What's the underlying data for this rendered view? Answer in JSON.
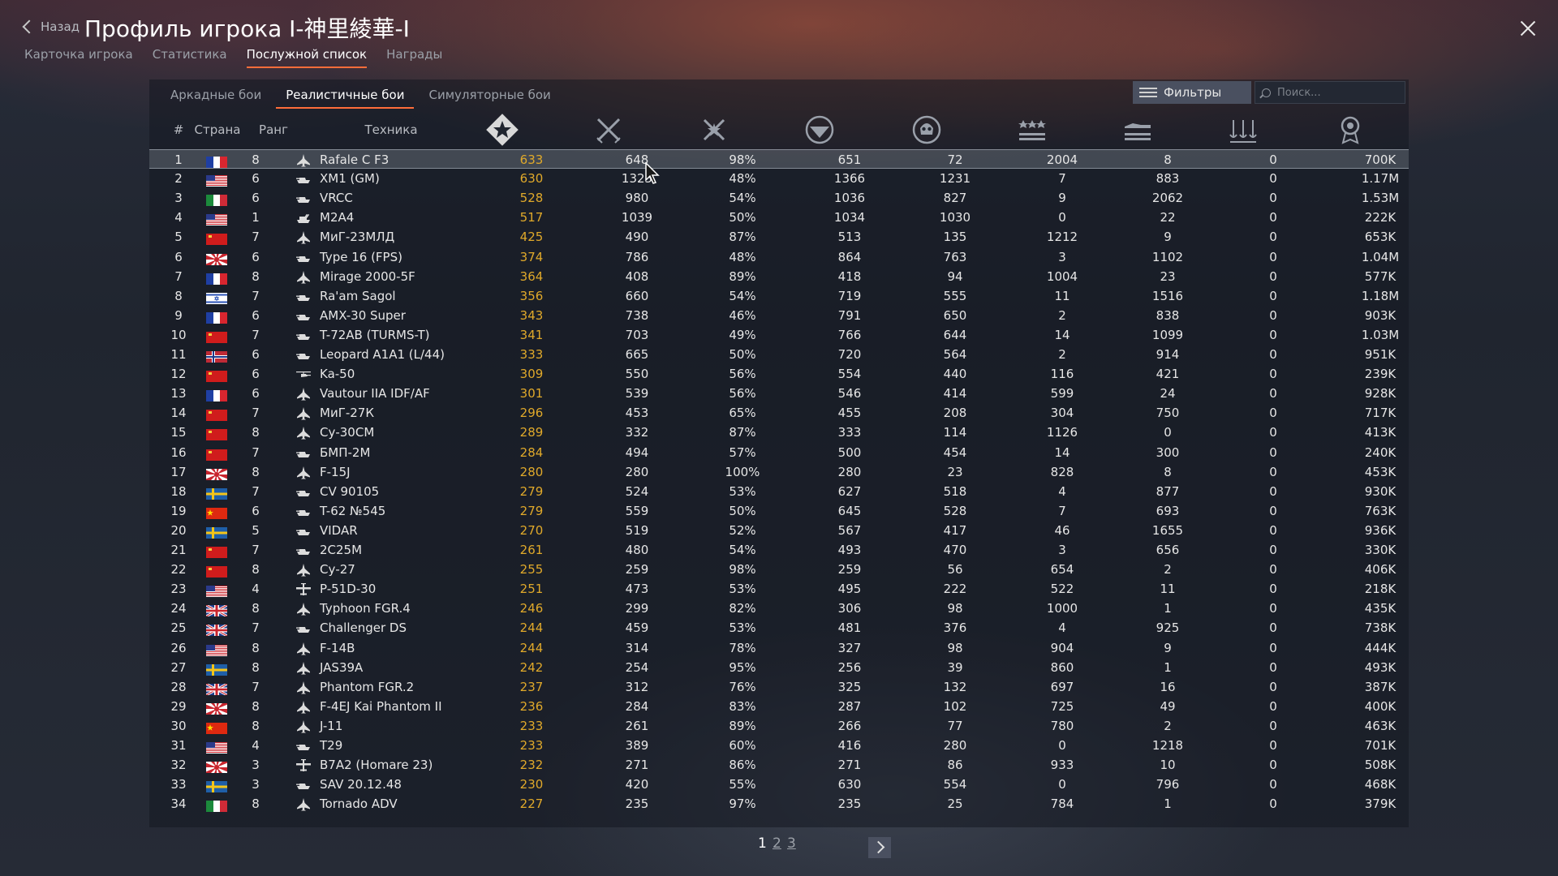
{
  "header": {
    "back_label": "Назад",
    "title": "Профиль игрока I-神里綾華-I",
    "tabs": [
      {
        "label": "Карточка игрока",
        "active": false
      },
      {
        "label": "Статистика",
        "active": false
      },
      {
        "label": "Послужной список",
        "active": true
      },
      {
        "label": "Награды",
        "active": false
      }
    ]
  },
  "modes": [
    {
      "label": "Аркадные бои",
      "active": false
    },
    {
      "label": "Реалистичные бои",
      "active": true
    },
    {
      "label": "Симуляторные бои",
      "active": false
    }
  ],
  "toolbar": {
    "filters_label": "Фильтры",
    "search_placeholder": "Поиск..."
  },
  "columns": {
    "index": "#",
    "country": "Страна",
    "rank": "Ранг",
    "vehicle": "Техника",
    "icons": [
      "rating-icon",
      "battles-icon",
      "win-rate-icon",
      "respawns-icon",
      "deaths-icon",
      "air-kills-icon",
      "ground-kills-icon",
      "naval-kills-icon",
      "silver-lions-icon"
    ]
  },
  "colors": {
    "accent": "#ff6d3a",
    "rating": "#e0a92a",
    "selected_row": "#5b626f"
  },
  "rows": [
    {
      "idx": "1",
      "flag": "fr",
      "rank": "8",
      "type": "jet",
      "name": "Rafale C F3",
      "rating": "633",
      "battles": "648",
      "win": "98%",
      "respawns": "651",
      "deaths": "72",
      "air": "2004",
      "ground": "8",
      "naval": "0",
      "sl": "700K"
    },
    {
      "idx": "2",
      "flag": "us",
      "rank": "6",
      "type": "tank",
      "name": "XM1 (GM)",
      "rating": "630",
      "battles": "1325",
      "win": "48%",
      "respawns": "1366",
      "deaths": "1231",
      "air": "7",
      "ground": "883",
      "naval": "0",
      "sl": "1.17M"
    },
    {
      "idx": "3",
      "flag": "it",
      "rank": "6",
      "type": "tank",
      "name": "VRCC",
      "rating": "528",
      "battles": "980",
      "win": "54%",
      "respawns": "1036",
      "deaths": "827",
      "air": "9",
      "ground": "2062",
      "naval": "0",
      "sl": "1.53M"
    },
    {
      "idx": "4",
      "flag": "us",
      "rank": "1",
      "type": "spaa",
      "name": "M2A4",
      "rating": "517",
      "battles": "1039",
      "win": "50%",
      "respawns": "1034",
      "deaths": "1030",
      "air": "0",
      "ground": "22",
      "naval": "0",
      "sl": "222K"
    },
    {
      "idx": "5",
      "flag": "su",
      "rank": "7",
      "type": "jet",
      "name": "МиГ-23МЛД",
      "rating": "425",
      "battles": "490",
      "win": "87%",
      "respawns": "513",
      "deaths": "135",
      "air": "1212",
      "ground": "9",
      "naval": "0",
      "sl": "653K"
    },
    {
      "idx": "6",
      "flag": "jp",
      "rank": "6",
      "type": "tank",
      "name": "Type 16 (FPS)",
      "rating": "374",
      "battles": "786",
      "win": "48%",
      "respawns": "864",
      "deaths": "763",
      "air": "3",
      "ground": "1102",
      "naval": "0",
      "sl": "1.04M"
    },
    {
      "idx": "7",
      "flag": "fr",
      "rank": "8",
      "type": "jet",
      "name": "Mirage 2000-5F",
      "rating": "364",
      "battles": "408",
      "win": "89%",
      "respawns": "418",
      "deaths": "94",
      "air": "1004",
      "ground": "23",
      "naval": "0",
      "sl": "577K"
    },
    {
      "idx": "8",
      "flag": "il",
      "rank": "7",
      "type": "tank",
      "name": "Ra'am Sagol",
      "rating": "356",
      "battles": "660",
      "win": "54%",
      "respawns": "719",
      "deaths": "555",
      "air": "11",
      "ground": "1516",
      "naval": "0",
      "sl": "1.18M"
    },
    {
      "idx": "9",
      "flag": "fr",
      "rank": "6",
      "type": "tank",
      "name": "AMX-30 Super",
      "rating": "343",
      "battles": "738",
      "win": "46%",
      "respawns": "791",
      "deaths": "650",
      "air": "2",
      "ground": "838",
      "naval": "0",
      "sl": "903K"
    },
    {
      "idx": "10",
      "flag": "su",
      "rank": "7",
      "type": "tank",
      "name": "T-72AB (TURMS-T)",
      "rating": "341",
      "battles": "703",
      "win": "49%",
      "respawns": "766",
      "deaths": "644",
      "air": "14",
      "ground": "1099",
      "naval": "0",
      "sl": "1.03M"
    },
    {
      "idx": "11",
      "flag": "no",
      "rank": "6",
      "type": "tank",
      "name": "Leopard A1A1 (L/44)",
      "rating": "333",
      "battles": "665",
      "win": "50%",
      "respawns": "720",
      "deaths": "564",
      "air": "2",
      "ground": "914",
      "naval": "0",
      "sl": "951K"
    },
    {
      "idx": "12",
      "flag": "su",
      "rank": "6",
      "type": "heli",
      "name": "Ka-50",
      "rating": "309",
      "battles": "550",
      "win": "56%",
      "respawns": "554",
      "deaths": "440",
      "air": "116",
      "ground": "421",
      "naval": "0",
      "sl": "239K"
    },
    {
      "idx": "13",
      "flag": "fr",
      "rank": "6",
      "type": "jet",
      "name": "Vautour IIA IDF/AF",
      "rating": "301",
      "battles": "539",
      "win": "56%",
      "respawns": "546",
      "deaths": "414",
      "air": "599",
      "ground": "24",
      "naval": "0",
      "sl": "928K"
    },
    {
      "idx": "14",
      "flag": "su",
      "rank": "7",
      "type": "jet",
      "name": "МиГ-27К",
      "rating": "296",
      "battles": "453",
      "win": "65%",
      "respawns": "455",
      "deaths": "208",
      "air": "304",
      "ground": "750",
      "naval": "0",
      "sl": "717K"
    },
    {
      "idx": "15",
      "flag": "su",
      "rank": "8",
      "type": "jet",
      "name": "Су-30СМ",
      "rating": "289",
      "battles": "332",
      "win": "87%",
      "respawns": "333",
      "deaths": "114",
      "air": "1126",
      "ground": "0",
      "naval": "0",
      "sl": "413K"
    },
    {
      "idx": "16",
      "flag": "su",
      "rank": "7",
      "type": "tank",
      "name": "БМП-2М",
      "rating": "284",
      "battles": "494",
      "win": "57%",
      "respawns": "500",
      "deaths": "454",
      "air": "14",
      "ground": "300",
      "naval": "0",
      "sl": "240K"
    },
    {
      "idx": "17",
      "flag": "jp",
      "rank": "8",
      "type": "jet",
      "name": "F-15J",
      "rating": "280",
      "battles": "280",
      "win": "100%",
      "respawns": "280",
      "deaths": "23",
      "air": "828",
      "ground": "8",
      "naval": "0",
      "sl": "453K"
    },
    {
      "idx": "18",
      "flag": "se",
      "rank": "7",
      "type": "tank",
      "name": "CV 90105",
      "rating": "279",
      "battles": "524",
      "win": "53%",
      "respawns": "627",
      "deaths": "518",
      "air": "4",
      "ground": "877",
      "naval": "0",
      "sl": "930K"
    },
    {
      "idx": "19",
      "flag": "cn",
      "rank": "6",
      "type": "tank",
      "name": "T-62 №545",
      "rating": "279",
      "battles": "559",
      "win": "50%",
      "respawns": "645",
      "deaths": "528",
      "air": "7",
      "ground": "693",
      "naval": "0",
      "sl": "763K"
    },
    {
      "idx": "20",
      "flag": "se",
      "rank": "5",
      "type": "tank",
      "name": "VIDAR",
      "rating": "270",
      "battles": "519",
      "win": "52%",
      "respawns": "567",
      "deaths": "417",
      "air": "46",
      "ground": "1655",
      "naval": "0",
      "sl": "936K"
    },
    {
      "idx": "21",
      "flag": "su",
      "rank": "7",
      "type": "tank",
      "name": "2С25М",
      "rating": "261",
      "battles": "480",
      "win": "54%",
      "respawns": "493",
      "deaths": "470",
      "air": "3",
      "ground": "656",
      "naval": "0",
      "sl": "330K"
    },
    {
      "idx": "22",
      "flag": "su",
      "rank": "8",
      "type": "jet",
      "name": "Су-27",
      "rating": "255",
      "battles": "259",
      "win": "98%",
      "respawns": "259",
      "deaths": "56",
      "air": "654",
      "ground": "2",
      "naval": "0",
      "sl": "406K"
    },
    {
      "idx": "23",
      "flag": "us",
      "rank": "4",
      "type": "prop",
      "name": "P-51D-30",
      "rating": "251",
      "battles": "473",
      "win": "53%",
      "respawns": "495",
      "deaths": "222",
      "air": "522",
      "ground": "11",
      "naval": "0",
      "sl": "218K"
    },
    {
      "idx": "24",
      "flag": "uk",
      "rank": "8",
      "type": "jet",
      "name": "Typhoon FGR.4",
      "rating": "246",
      "battles": "299",
      "win": "82%",
      "respawns": "306",
      "deaths": "98",
      "air": "1000",
      "ground": "1",
      "naval": "0",
      "sl": "435K"
    },
    {
      "idx": "25",
      "flag": "uk",
      "rank": "7",
      "type": "tank",
      "name": "Challenger DS",
      "rating": "244",
      "battles": "459",
      "win": "53%",
      "respawns": "481",
      "deaths": "376",
      "air": "4",
      "ground": "925",
      "naval": "0",
      "sl": "738K"
    },
    {
      "idx": "26",
      "flag": "us",
      "rank": "8",
      "type": "jet",
      "name": "F-14B",
      "rating": "244",
      "battles": "314",
      "win": "78%",
      "respawns": "327",
      "deaths": "98",
      "air": "904",
      "ground": "9",
      "naval": "0",
      "sl": "444K"
    },
    {
      "idx": "27",
      "flag": "se",
      "rank": "8",
      "type": "jet",
      "name": "JAS39A",
      "rating": "242",
      "battles": "254",
      "win": "95%",
      "respawns": "256",
      "deaths": "39",
      "air": "860",
      "ground": "1",
      "naval": "0",
      "sl": "493K"
    },
    {
      "idx": "28",
      "flag": "uk",
      "rank": "7",
      "type": "jet",
      "name": "Phantom FGR.2",
      "rating": "237",
      "battles": "312",
      "win": "76%",
      "respawns": "325",
      "deaths": "132",
      "air": "697",
      "ground": "16",
      "naval": "0",
      "sl": "387K"
    },
    {
      "idx": "29",
      "flag": "jp",
      "rank": "8",
      "type": "jet",
      "name": "F-4EJ Kai Phantom II",
      "rating": "236",
      "battles": "284",
      "win": "83%",
      "respawns": "287",
      "deaths": "102",
      "air": "725",
      "ground": "49",
      "naval": "0",
      "sl": "400K"
    },
    {
      "idx": "30",
      "flag": "cn",
      "rank": "8",
      "type": "jet",
      "name": "J-11",
      "rating": "233",
      "battles": "261",
      "win": "89%",
      "respawns": "266",
      "deaths": "77",
      "air": "780",
      "ground": "2",
      "naval": "0",
      "sl": "463K"
    },
    {
      "idx": "31",
      "flag": "us",
      "rank": "4",
      "type": "tank",
      "name": "T29",
      "rating": "233",
      "battles": "389",
      "win": "60%",
      "respawns": "416",
      "deaths": "280",
      "air": "0",
      "ground": "1218",
      "naval": "0",
      "sl": "701K"
    },
    {
      "idx": "32",
      "flag": "jp",
      "rank": "3",
      "type": "prop",
      "name": "B7A2 (Homare 23)",
      "rating": "232",
      "battles": "271",
      "win": "86%",
      "respawns": "271",
      "deaths": "86",
      "air": "933",
      "ground": "10",
      "naval": "0",
      "sl": "508K"
    },
    {
      "idx": "33",
      "flag": "se",
      "rank": "3",
      "type": "tank",
      "name": "SAV 20.12.48",
      "rating": "230",
      "battles": "420",
      "win": "55%",
      "respawns": "630",
      "deaths": "554",
      "air": "0",
      "ground": "796",
      "naval": "0",
      "sl": "468K"
    },
    {
      "idx": "34",
      "flag": "it",
      "rank": "8",
      "type": "jet",
      "name": "Tornado ADV",
      "rating": "227",
      "battles": "235",
      "win": "97%",
      "respawns": "235",
      "deaths": "25",
      "air": "784",
      "ground": "1",
      "naval": "0",
      "sl": "379K"
    }
  ],
  "pagination": {
    "pages": [
      "1",
      "2",
      "3"
    ],
    "current": "1"
  }
}
